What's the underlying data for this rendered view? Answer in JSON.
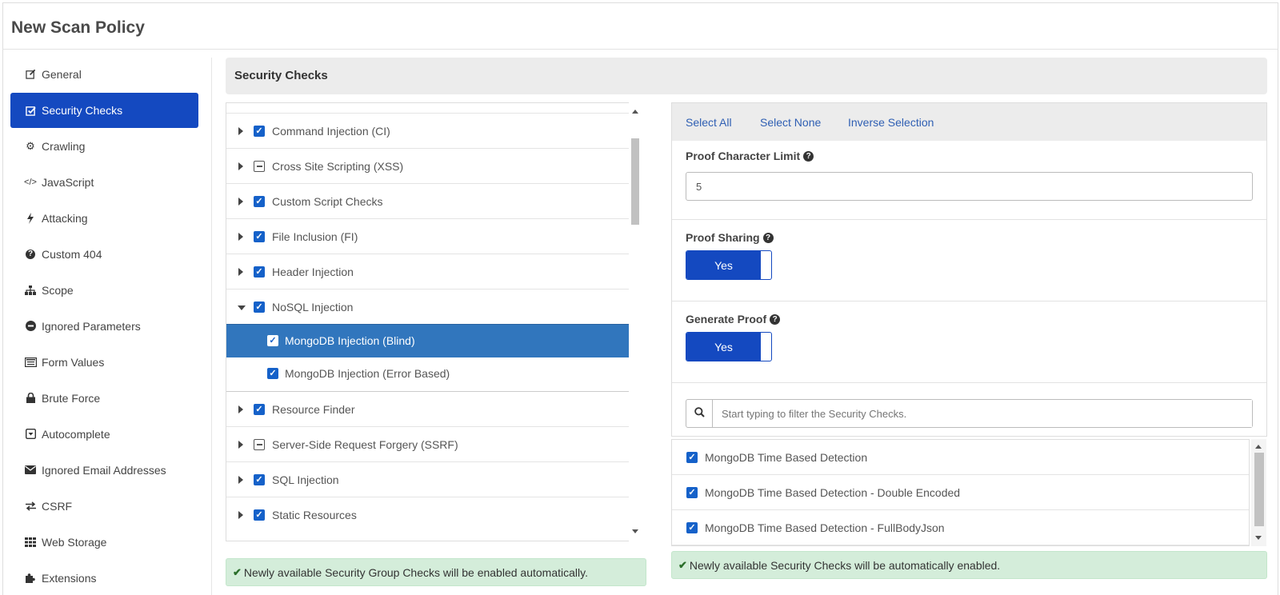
{
  "page": {
    "title": "New Scan Policy"
  },
  "sidebar": {
    "items": [
      {
        "label": "General",
        "icon": "edit-icon"
      },
      {
        "label": "Security Checks",
        "icon": "check-square-icon",
        "active": true
      },
      {
        "label": "Crawling",
        "icon": "gears-icon"
      },
      {
        "label": "JavaScript",
        "icon": "code-icon"
      },
      {
        "label": "Attacking",
        "icon": "bolt-icon"
      },
      {
        "label": "Custom 404",
        "icon": "question-circle-icon"
      },
      {
        "label": "Scope",
        "icon": "sitemap-icon"
      },
      {
        "label": "Ignored Parameters",
        "icon": "minus-circle-icon"
      },
      {
        "label": "Form Values",
        "icon": "list-alt-icon"
      },
      {
        "label": "Brute Force",
        "icon": "lock-icon"
      },
      {
        "label": "Autocomplete",
        "icon": "caret-square-down-icon"
      },
      {
        "label": "Ignored Email Addresses",
        "icon": "envelope-icon"
      },
      {
        "label": "CSRF",
        "icon": "exchange-icon"
      },
      {
        "label": "Web Storage",
        "icon": "th-icon"
      },
      {
        "label": "Extensions",
        "icon": "puzzle-icon"
      }
    ]
  },
  "panel": {
    "title": "Security Checks"
  },
  "tree": {
    "rows": [
      {
        "label": "Command Injection (CI)",
        "state": "checked",
        "expand": "collapsed"
      },
      {
        "label": "Cross Site Scripting (XSS)",
        "state": "partial",
        "expand": "collapsed"
      },
      {
        "label": "Custom Script Checks",
        "state": "checked",
        "expand": "collapsed"
      },
      {
        "label": "File Inclusion (FI)",
        "state": "checked",
        "expand": "collapsed"
      },
      {
        "label": "Header Injection",
        "state": "checked",
        "expand": "collapsed"
      },
      {
        "label": "NoSQL Injection",
        "state": "checked",
        "expand": "expanded"
      },
      {
        "label": "MongoDB Injection (Blind)",
        "state": "checked",
        "child": true,
        "selected": true
      },
      {
        "label": "MongoDB Injection (Error Based)",
        "state": "checked",
        "child": true
      },
      {
        "label": "Resource Finder",
        "state": "checked",
        "expand": "collapsed"
      },
      {
        "label": "Server-Side Request Forgery (SSRF)",
        "state": "partial",
        "expand": "collapsed"
      },
      {
        "label": "SQL Injection",
        "state": "checked",
        "expand": "collapsed"
      },
      {
        "label": "Static Resources",
        "state": "checked",
        "expand": "collapsed"
      }
    ]
  },
  "details": {
    "toolbar": {
      "select_all": "Select All",
      "select_none": "Select None",
      "inverse_selection": "Inverse Selection"
    },
    "proof_limit": {
      "label": "Proof Character Limit",
      "value": "5"
    },
    "proof_sharing": {
      "label": "Proof Sharing",
      "value": "Yes"
    },
    "generate_proof": {
      "label": "Generate Proof",
      "value": "Yes"
    },
    "filter": {
      "placeholder": "Start typing to filter the Security Checks."
    }
  },
  "checks": {
    "items": [
      {
        "label": "MongoDB Time Based Detection",
        "checked": true
      },
      {
        "label": "MongoDB Time Based Detection - Double Encoded",
        "checked": true
      },
      {
        "label": "MongoDB Time Based Detection - FullBodyJson",
        "checked": true
      }
    ]
  },
  "alerts": {
    "group": "Newly available Security Group Checks will be enabled automatically.",
    "checks": "Newly available Security Checks will be automatically enabled."
  },
  "colors": {
    "accent": "#1449c0",
    "selected_row": "#3176bd",
    "checkbox": "#1561c9",
    "alert_bg": "#d4edda"
  }
}
